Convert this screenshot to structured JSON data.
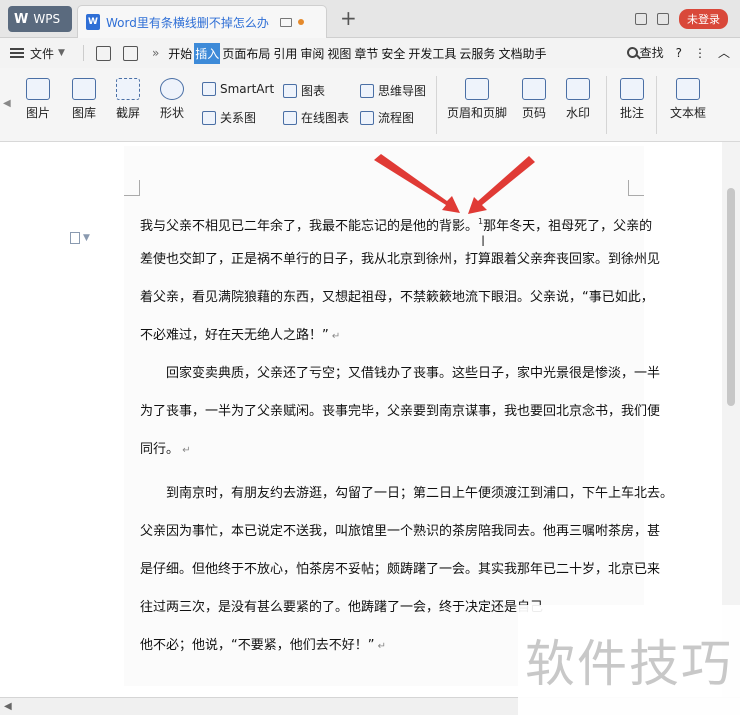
{
  "titlebar": {
    "app_name": "WPS",
    "doc_tab_title": "Word里有条横线删不掉怎么办",
    "new_tab": "+",
    "login": "未登录"
  },
  "menubar": {
    "file": "文件",
    "tabs": [
      "开始",
      "插入",
      "页面布局",
      "引用",
      "审阅",
      "视图",
      "章节",
      "安全",
      "开发工具",
      "云服务",
      "文档助手"
    ],
    "active_tab": "插入",
    "search": "查找",
    "help": "?"
  },
  "ribbon": {
    "big": [
      "图片",
      "图库",
      "截屏",
      "形状"
    ],
    "small": [
      "SmartArt",
      "关系图",
      "图表",
      "在线图表",
      "思维导图",
      "流程图"
    ],
    "header": "页眉和页脚",
    "page_num": "页码",
    "watermark": "水印",
    "comment": "批注",
    "textbox": "文本框"
  },
  "document": {
    "p1": [
      "我与父亲不相见已二年余了，我最不能忘记的是他的背影。",
      "那年冬天，祖母死了，父亲的",
      "差使也交卸了，正是祸不单行的日子，我从北京到徐州，打算跟着父亲奔丧回家。到徐州见",
      "着父亲，看见满院狼藉的东西，又想起祖母，不禁簌簌地流下眼泪。父亲说，“事已如此，",
      "不必难过，好在天无绝人之路！”"
    ],
    "footnote_mark": "1",
    "p2": [
      "回家变卖典质，父亲还了亏空；又借钱办了丧事。这些日子，家中光景很是惨淡，一半",
      "为了丧事，一半为了父亲赋闲。丧事完毕，父亲要到南京谋事，我也要回北京念书，我们便",
      "同行。"
    ],
    "p3": [
      "到南京时，有朋友约去游逛，勾留了一日；第二日上午便须渡江到浦口，下午上车北去。",
      "父亲因为事忙，本已说定不送我，叫旅馆里一个熟识的茶房陪我同去。他再三嘱咐茶房，甚",
      "是仔细。但他终于不放心，怕茶房不妥帖；颇踌躇了一会。其实我那年已二十岁，北京已来",
      "往过两三次，是没有甚么要紧的了。他踌躇了一会，终于决定还是自己",
      "他不必；他说，“不要紧，他们去不好！”"
    ]
  },
  "watermark_text": "软件技巧",
  "colors": {
    "accent": "#3d8ad8",
    "arrow": "#e03a35",
    "login": "#d9483a"
  }
}
